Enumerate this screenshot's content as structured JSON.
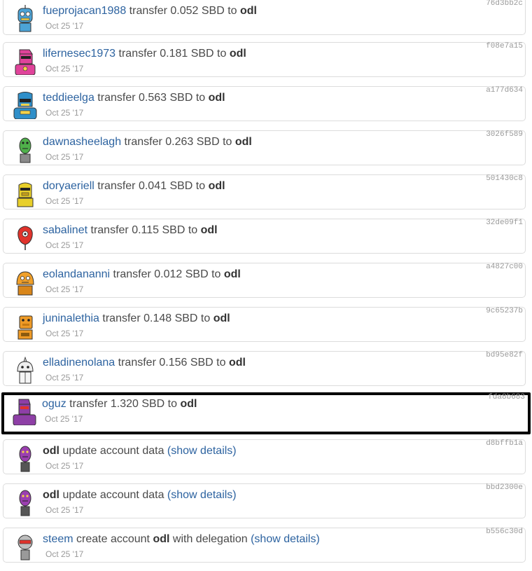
{
  "colors": {
    "link": "#2d63a0",
    "text": "#4a4a4a",
    "muted": "#9a9a9a",
    "border": "#dcdcdc",
    "highlight": "#000000"
  },
  "rows": [
    {
      "user": "fueprojacan1988",
      "action": "transfer 0.052 SBD to",
      "target": "odl",
      "date": "Oct 25 '17",
      "hash": "76d3bb2c",
      "avatar_icon": "robot-avatar-blue-icon",
      "avatar_color": "#4ca3d6"
    },
    {
      "user": "lifernesec1973",
      "action": "transfer 0.181 SBD to",
      "target": "odl",
      "date": "Oct 25 '17",
      "hash": "f08e7a15",
      "avatar_icon": "robot-avatar-pink-icon",
      "avatar_color": "#e0439a"
    },
    {
      "user": "teddieelga",
      "action": "transfer 0.563 SBD to",
      "target": "odl",
      "date": "Oct 25 '17",
      "hash": "a177d634",
      "avatar_icon": "robot-avatar-blue-icon",
      "avatar_color": "#2f8fc9"
    },
    {
      "user": "dawnasheelagh",
      "action": "transfer 0.263 SBD to",
      "target": "odl",
      "date": "Oct 25 '17",
      "hash": "3026f589",
      "avatar_icon": "robot-avatar-green-icon",
      "avatar_color": "#4fb04a"
    },
    {
      "user": "doryaeriell",
      "action": "transfer 0.041 SBD to",
      "target": "odl",
      "date": "Oct 25 '17",
      "hash": "501430c8",
      "avatar_icon": "robot-avatar-yellow-icon",
      "avatar_color": "#e8cf2a"
    },
    {
      "user": "sabalinet",
      "action": "transfer 0.115 SBD to",
      "target": "odl",
      "date": "Oct 25 '17",
      "hash": "32de09f1",
      "avatar_icon": "robot-avatar-red-icon",
      "avatar_color": "#e0332c"
    },
    {
      "user": "eolandananni",
      "action": "transfer 0.012 SBD to",
      "target": "odl",
      "date": "Oct 25 '17",
      "hash": "a4827c00",
      "avatar_icon": "robot-avatar-orange-icon",
      "avatar_color": "#f0a02a"
    },
    {
      "user": "juninalethia",
      "action": "transfer 0.148 SBD to",
      "target": "odl",
      "date": "Oct 25 '17",
      "hash": "9c65237b",
      "avatar_icon": "robot-avatar-orange-icon",
      "avatar_color": "#ee9a26"
    },
    {
      "user": "elladinenolana",
      "action": "transfer 0.156 SBD to",
      "target": "odl",
      "date": "Oct 25 '17",
      "hash": "bd95e82f",
      "avatar_icon": "robot-avatar-white-icon",
      "avatar_color": "#eeeeee"
    },
    {
      "user": "oguz",
      "action": "transfer 1.320 SBD to",
      "target": "odl",
      "date": "Oct 25 '17",
      "hash": "fda8b683",
      "avatar_icon": "robot-avatar-purple-icon",
      "avatar_color": "#8e3fa6"
    },
    {
      "user": "odl",
      "action": "update account data",
      "link": "(show details)",
      "date": "Oct 25 '17",
      "hash": "d8bffb1a",
      "avatar_icon": "robot-avatar-purple-icon",
      "avatar_color": "#9b3fb0"
    },
    {
      "user": "odl",
      "action": "update account data",
      "link": "(show details)",
      "date": "Oct 25 '17",
      "hash": "bbd2300e",
      "avatar_icon": "robot-avatar-purple-icon",
      "avatar_color": "#9b3fb0"
    },
    {
      "user": "steem",
      "action": "create account",
      "target": "odl",
      "action2": "with delegation",
      "link": "(show details)",
      "date": "Oct 25 '17",
      "hash": "b556c30d",
      "avatar_icon": "robot-avatar-gray-icon",
      "avatar_color": "#9a9a9a"
    }
  ]
}
